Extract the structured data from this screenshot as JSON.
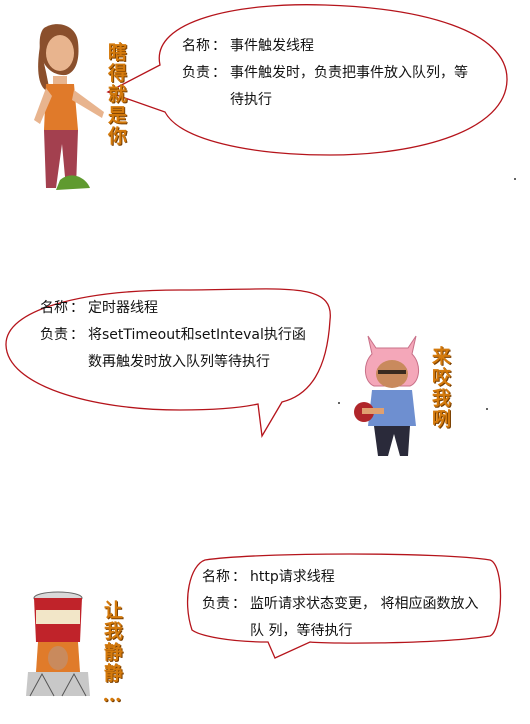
{
  "panels": [
    {
      "name_label": "名称",
      "name_value": "事件触发线程",
      "duty_label": "负责",
      "duty_value": "事件触发时，负责把事件放入队列，等待执行",
      "caption": "瞎得就是你"
    },
    {
      "name_label": "名称",
      "name_value": "定时器线程",
      "duty_label": "负责",
      "duty_value": "将setTimeout和setInteval执行函数再触发时放入队列等待执行",
      "caption": "来咬我咧"
    },
    {
      "name_label": "名称",
      "name_value": "http请求线程",
      "duty_label": "负责",
      "duty_value": "监听请求状态变更， 将相应函数放入队 列，等待执行",
      "caption": "让我静静…"
    }
  ],
  "colors": {
    "bubble_stroke": "#b5141b",
    "caption": "#d47a0c"
  },
  "icons": [
    "woman-pointing-sticker",
    "pig-hat-man-sticker",
    "bucket-head-man-sticker"
  ]
}
